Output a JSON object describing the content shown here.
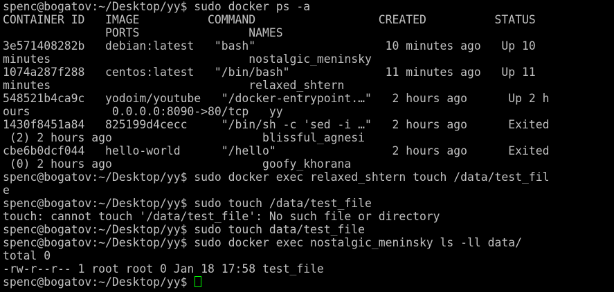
{
  "terminal": {
    "text_color": "#c0c0c0",
    "background": "#000000",
    "cursor_color": "#00ff00",
    "lines": [
      "spenc@bogatov:~/Desktop/yy$ sudo docker ps -a",
      "CONTAINER ID   IMAGE          COMMAND                  CREATED          STATUS",
      "               PORTS                NAMES",
      "3e571408282b   debian:latest   \"bash\"                   10 minutes ago   Up 10",
      "minutes                             nostalgic_meninsky",
      "1074a287f288   centos:latest   \"/bin/bash\"              11 minutes ago   Up 11",
      "minutes                             relaxed_shtern",
      "548521b4ca9c   yodoim/youtube   \"/docker-entrypoint.…\"   2 hours ago      Up 2 h",
      "ours            0.0.0.0:8090->80/tcp   yy",
      "1430f8451a84   825199d4cecc     \"/bin/sh -c 'sed -i …\"   2 hours ago      Exited",
      " (2) 2 hours ago                      blissful_agnesi",
      "cbe6b0dcf044   hello-world      \"/hello\"                 2 hours ago      Exited",
      " (0) 2 hours ago                      goofy_khorana",
      "spenc@bogatov:~/Desktop/yy$ sudo docker exec relaxed_shtern touch /data/test_fil",
      "e",
      "spenc@bogatov:~/Desktop/yy$ sudo touch /data/test_file",
      "touch: cannot touch '/data/test_file': No such file or directory",
      "spenc@bogatov:~/Desktop/yy$ sudo touch data/test_file",
      "spenc@bogatov:~/Desktop/yy$ sudo docker exec nostalgic_meninsky ls -ll data/",
      "total 0",
      "-rw-r--r-- 1 root root 0 Jan 18 17:58 test_file"
    ],
    "prompt": "spenc@bogatov:~/Desktop/yy$ "
  }
}
